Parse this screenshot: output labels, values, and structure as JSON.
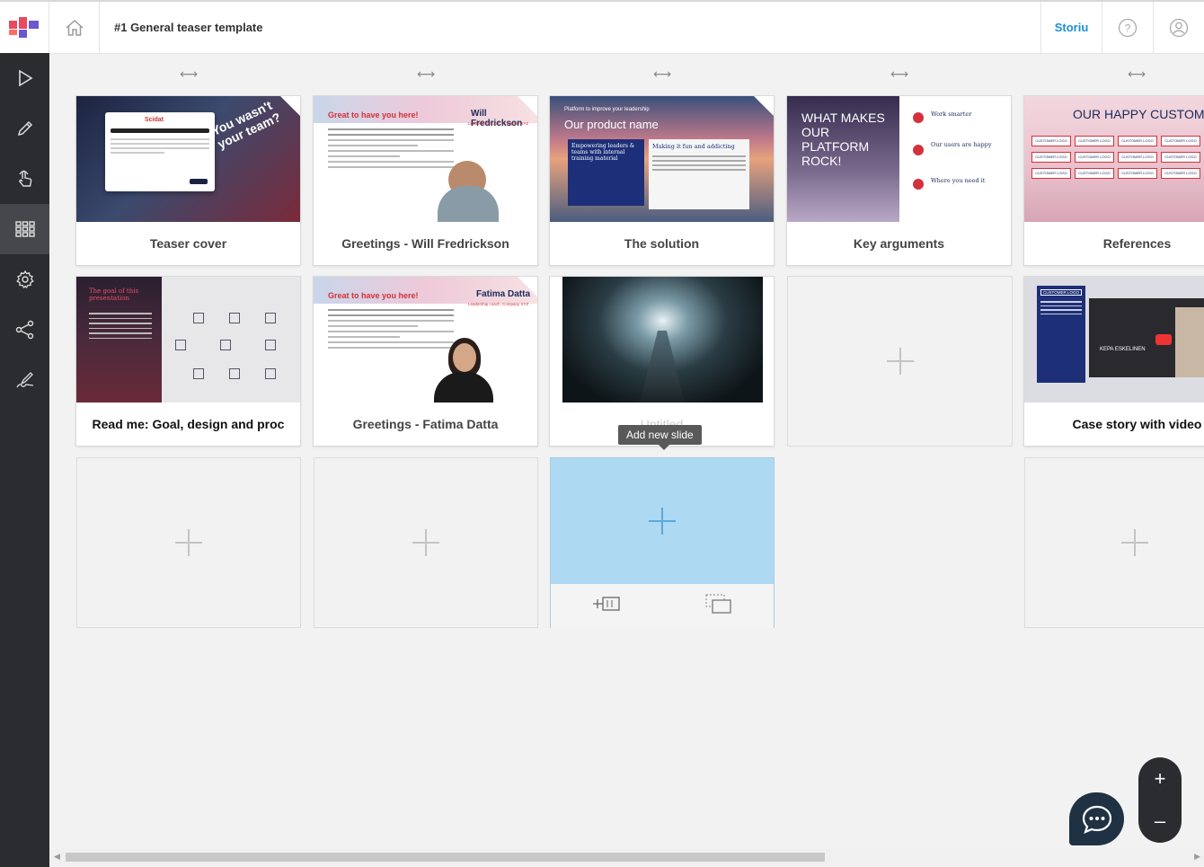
{
  "header": {
    "title": "#1 General teaser template",
    "brand": "Storiu"
  },
  "sidebar": {
    "items": [
      {
        "icon": "play-icon",
        "label": "Present"
      },
      {
        "icon": "pencil-icon",
        "label": "Edit"
      },
      {
        "icon": "touch-icon",
        "label": "Interact"
      },
      {
        "icon": "grid-icon",
        "label": "Overview",
        "active": true
      },
      {
        "icon": "gear-icon",
        "label": "Settings"
      },
      {
        "icon": "share-icon",
        "label": "Share"
      },
      {
        "icon": "sign-icon",
        "label": "Sign"
      }
    ]
  },
  "slides": {
    "row1": [
      {
        "label": "Teaser cover"
      },
      {
        "label": "Greetings - Will Fredrickson"
      },
      {
        "label": "The solution"
      },
      {
        "label": "Key arguments"
      },
      {
        "label": "References"
      }
    ],
    "row2": [
      {
        "label": "Read me: Goal, design and proc"
      },
      {
        "label": "Greetings - Fatima Datta"
      },
      {
        "label": "Untitled"
      },
      {
        "label": ""
      },
      {
        "label": "Case story with video"
      }
    ]
  },
  "thumb_text": {
    "cover_brand": "Scidat",
    "cover_banner": "You wasn't your team?",
    "greet_headline": "Great to have you here!",
    "will_name": "Will Fredrickson",
    "will_role": "Leadership coach, Company XYZ",
    "fatima_name": "Fatima Datta",
    "fatima_role": "Leadership coach, Company XYZ",
    "solution_top": "Platform to improve your leadership",
    "solution_title": "Our product name",
    "solution_box1": "Empowering leaders & teams with internal training material",
    "solution_box2": "Making it fun and addicting",
    "key_title": "WHAT MAKES OUR PLATFORM ROCK!",
    "key_p1": "Work smarter",
    "key_p2": "Our users are happy",
    "key_p3": "Where you need it",
    "ref_title": "OUR HAPPY CUSTOMERS",
    "ref_logo": "CUSTOMER LOGO",
    "readme_title": "The goal of this presentation",
    "case_logo": "CUSTOMER LOGO",
    "case_person": "KEPA ESKELINEN"
  },
  "tooltip": "Add new slide",
  "zoom": {
    "plus": "+",
    "minus": "–"
  }
}
